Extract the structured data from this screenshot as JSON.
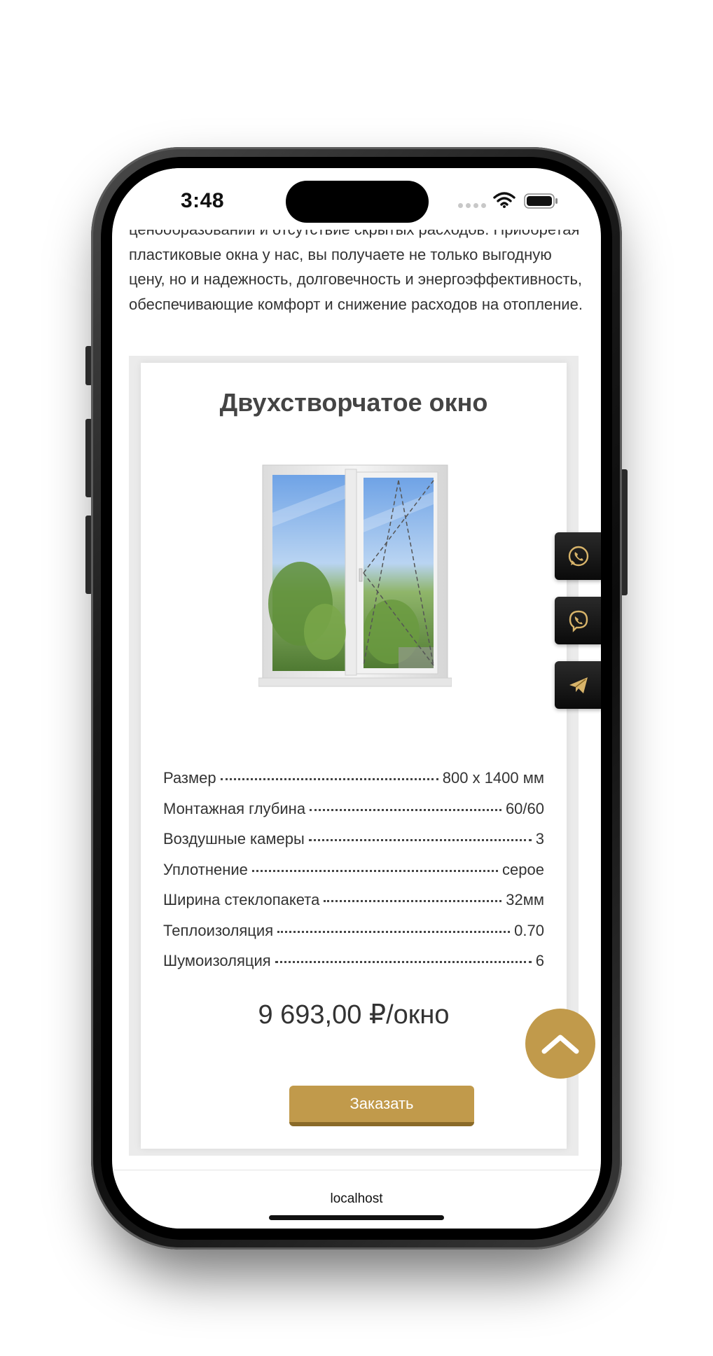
{
  "status_bar": {
    "time": "3:48"
  },
  "intro": {
    "text": "ценообразовании и отсутствие скрытых расходов. Приобретая пластиковые окна у нас, вы получаете не только выгодную цену, но и надежность, долговечность и энергоэффективность, обеспечивающие комфорт и снижение расходов на отопление."
  },
  "product": {
    "title": "Двухстворчатое окно",
    "image": "double-casement-window-image",
    "specs": [
      {
        "label": "Размер",
        "value": "800 x 1400 мм"
      },
      {
        "label": "Монтажная глубина",
        "value": "60/60"
      },
      {
        "label": "Воздушные камеры",
        "value": "3"
      },
      {
        "label": "Уплотнение",
        "value": "серое"
      },
      {
        "label": "Ширина стеклопакета",
        "value": "32мм"
      },
      {
        "label": "Теплоизоляция",
        "value": "0.70"
      },
      {
        "label": "Шумоизоляция",
        "value": "6"
      }
    ],
    "price": "9 693,00 ₽/окно",
    "order_label": "Заказать"
  },
  "messengers": [
    {
      "icon": "whatsapp-icon"
    },
    {
      "icon": "viber-icon"
    },
    {
      "icon": "telegram-icon"
    }
  ],
  "scroll_top": {
    "icon": "chevron-up-icon"
  },
  "browser": {
    "url": "localhost"
  },
  "colors": {
    "accent": "#c19a4b",
    "accent_dark": "#8a6a28",
    "text": "#333333",
    "title": "#444444"
  }
}
